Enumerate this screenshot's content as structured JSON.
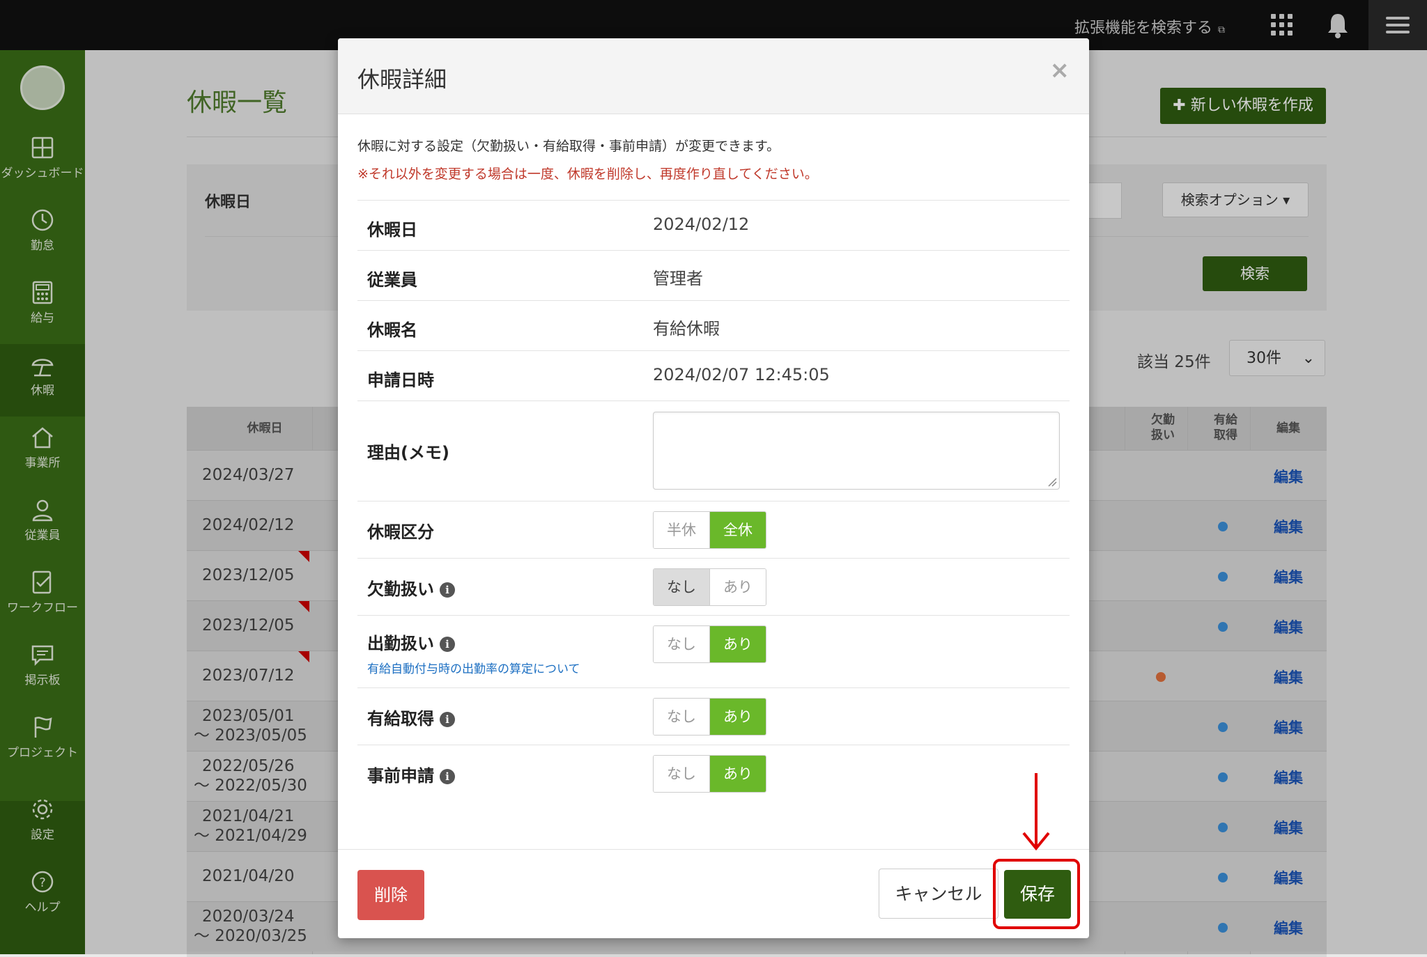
{
  "topbar": {
    "extension_search": "拡張機能を検索する",
    "icons": [
      "external-link-icon",
      "apps-grid-icon",
      "bell-icon",
      "hamburger-menu-icon"
    ]
  },
  "sidebar": {
    "items": [
      {
        "label": "ダッシュボード",
        "icon": "dashboard-icon"
      },
      {
        "label": "勤怠",
        "icon": "clock-icon"
      },
      {
        "label": "給与",
        "icon": "calculator-icon"
      },
      {
        "label": "休暇",
        "icon": "umbrella-icon",
        "active": true
      },
      {
        "label": "事業所",
        "icon": "home-icon"
      },
      {
        "label": "従業員",
        "icon": "person-icon"
      },
      {
        "label": "ワークフロー",
        "icon": "checklist-icon"
      },
      {
        "label": "掲示板",
        "icon": "message-icon"
      },
      {
        "label": "プロジェクト",
        "icon": "flag-icon"
      },
      {
        "label": "設定",
        "icon": "gear-icon"
      },
      {
        "label": "ヘルプ",
        "icon": "help-icon"
      }
    ]
  },
  "page": {
    "title": "休暇一覧",
    "new_button": "新しい休暇を作成",
    "search_label": "休暇日",
    "search_options": "検索オプション",
    "search_button": "検索",
    "count": "該当 25件",
    "per_page": "30件",
    "table": {
      "headers": {
        "date": "休暇日",
        "absence": "欠勤\n扱い",
        "paid": "有給\n取得",
        "edit": "編集"
      },
      "edit_label": "編集",
      "rows": [
        {
          "date": "2024/03/27",
          "date2": ""
        },
        {
          "date": "2024/02/12",
          "date2": ""
        },
        {
          "date": "2023/12/05",
          "date2": ""
        },
        {
          "date": "2023/12/05",
          "date2": ""
        },
        {
          "date": "2023/07/12",
          "date2": ""
        },
        {
          "date": "2023/05/01",
          "date2": "～ 2023/05/05"
        },
        {
          "date": "2022/05/26",
          "date2": "～ 2022/05/30"
        },
        {
          "date": "2021/04/21",
          "date2": "～ 2021/04/29"
        },
        {
          "date": "2021/04/20",
          "date2": ""
        },
        {
          "date": "2020/03/24",
          "date2": "～ 2020/03/25"
        }
      ]
    }
  },
  "modal": {
    "title": "休暇詳細",
    "close": "×",
    "description": "休暇に対する設定（欠勤扱い・有給取得・事前申請）が変更できます。",
    "warning": "※それ以外を変更する場合は一度、休暇を削除し、再度作り直してください。",
    "fields": {
      "date": {
        "label": "休暇日",
        "value": "2024/02/12"
      },
      "employee": {
        "label": "従業員",
        "value": "管理者"
      },
      "name": {
        "label": "休暇名",
        "value": "有給休暇"
      },
      "applied_at": {
        "label": "申請日時",
        "value": "2024/02/07 12:45:05"
      },
      "memo": {
        "label": "理由(メモ)",
        "value": ""
      }
    },
    "toggles": {
      "category": {
        "label": "休暇区分",
        "options": [
          "半休",
          "全休"
        ],
        "selected": "全休"
      },
      "absence": {
        "label": "欠勤扱い",
        "options": [
          "なし",
          "あり"
        ],
        "selected": "なし"
      },
      "attendance": {
        "label": "出勤扱い",
        "options": [
          "なし",
          "あり"
        ],
        "selected": "あり",
        "link": "有給自動付与時の出勤率の算定について"
      },
      "paid": {
        "label": "有給取得",
        "options": [
          "なし",
          "あり"
        ],
        "selected": "あり"
      },
      "prior": {
        "label": "事前申請",
        "options": [
          "なし",
          "あり"
        ],
        "selected": "あり"
      }
    },
    "info_glyph": "i",
    "buttons": {
      "delete": "削除",
      "cancel": "キャンセル",
      "save": "保存"
    }
  },
  "colors": {
    "brand_green": "#3a6d16",
    "toggle_green": "#6ab82a",
    "danger": "#d9534f",
    "highlight": "#e00000"
  }
}
